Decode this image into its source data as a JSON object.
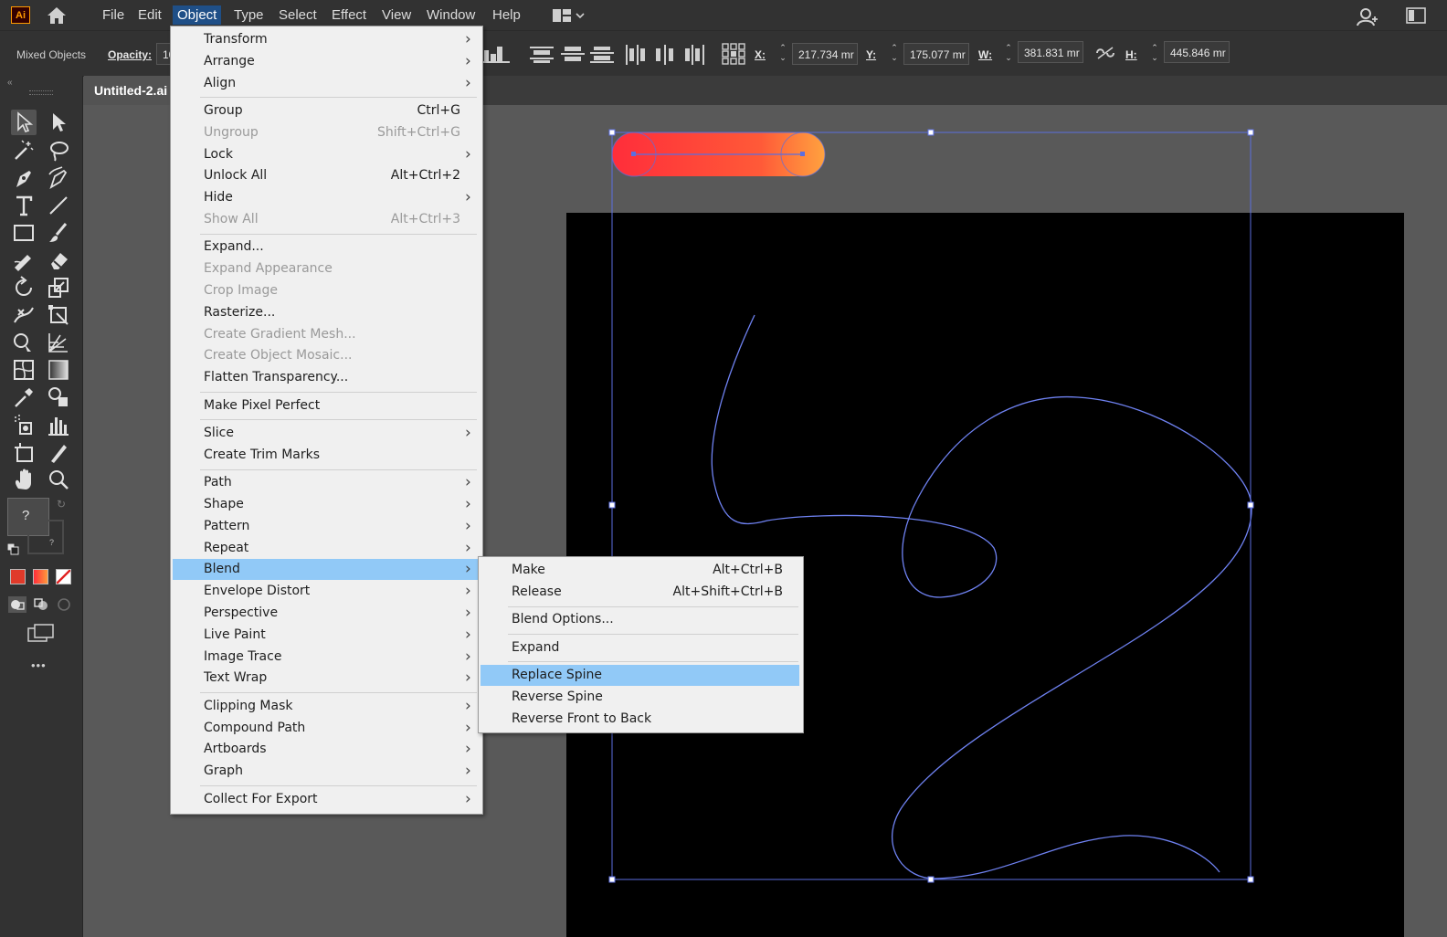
{
  "app": {
    "logo": "Ai"
  },
  "menubar": {
    "items": [
      "File",
      "Edit",
      "Object",
      "Type",
      "Select",
      "Effect",
      "View",
      "Window",
      "Help"
    ],
    "active": "Object"
  },
  "controlbar": {
    "selection_label": "Mixed Objects",
    "opacity_label": "Opacity:",
    "opacity_value": "10",
    "x_label": "X:",
    "x_value": "217.734 mr",
    "y_label": "Y:",
    "y_value": "175.077 mr",
    "w_label": "W:",
    "w_value": "381.831 mr",
    "h_label": "H:",
    "h_value": "445.846 mr"
  },
  "document": {
    "tab_title": "Untitled-2.ai"
  },
  "toolbar": {
    "fill_stroke_unknown": "?",
    "more": "•••"
  },
  "object_menu": [
    {
      "label": "Transform",
      "shortcut": "",
      "submenu": true,
      "disabled": false
    },
    {
      "label": "Arrange",
      "shortcut": "",
      "submenu": true,
      "disabled": false
    },
    {
      "label": "Align",
      "shortcut": "",
      "submenu": true,
      "disabled": false,
      "sep_after": true
    },
    {
      "label": "Group",
      "shortcut": "Ctrl+G",
      "submenu": false,
      "disabled": false
    },
    {
      "label": "Ungroup",
      "shortcut": "Shift+Ctrl+G",
      "submenu": false,
      "disabled": true
    },
    {
      "label": "Lock",
      "shortcut": "",
      "submenu": true,
      "disabled": false
    },
    {
      "label": "Unlock All",
      "shortcut": "Alt+Ctrl+2",
      "submenu": false,
      "disabled": false
    },
    {
      "label": "Hide",
      "shortcut": "",
      "submenu": true,
      "disabled": false
    },
    {
      "label": "Show All",
      "shortcut": "Alt+Ctrl+3",
      "submenu": false,
      "disabled": true,
      "sep_after": true
    },
    {
      "label": "Expand...",
      "shortcut": "",
      "submenu": false,
      "disabled": false
    },
    {
      "label": "Expand Appearance",
      "shortcut": "",
      "submenu": false,
      "disabled": true
    },
    {
      "label": "Crop Image",
      "shortcut": "",
      "submenu": false,
      "disabled": true
    },
    {
      "label": "Rasterize...",
      "shortcut": "",
      "submenu": false,
      "disabled": false
    },
    {
      "label": "Create Gradient Mesh...",
      "shortcut": "",
      "submenu": false,
      "disabled": true
    },
    {
      "label": "Create Object Mosaic...",
      "shortcut": "",
      "submenu": false,
      "disabled": true
    },
    {
      "label": "Flatten Transparency...",
      "shortcut": "",
      "submenu": false,
      "disabled": false,
      "sep_after": true
    },
    {
      "label": "Make Pixel Perfect",
      "shortcut": "",
      "submenu": false,
      "disabled": false,
      "sep_after": true
    },
    {
      "label": "Slice",
      "shortcut": "",
      "submenu": true,
      "disabled": false
    },
    {
      "label": "Create Trim Marks",
      "shortcut": "",
      "submenu": false,
      "disabled": false,
      "sep_after": true
    },
    {
      "label": "Path",
      "shortcut": "",
      "submenu": true,
      "disabled": false
    },
    {
      "label": "Shape",
      "shortcut": "",
      "submenu": true,
      "disabled": false
    },
    {
      "label": "Pattern",
      "shortcut": "",
      "submenu": true,
      "disabled": false
    },
    {
      "label": "Repeat",
      "shortcut": "",
      "submenu": true,
      "disabled": false
    },
    {
      "label": "Blend",
      "shortcut": "",
      "submenu": true,
      "disabled": false,
      "highlighted": true
    },
    {
      "label": "Envelope Distort",
      "shortcut": "",
      "submenu": true,
      "disabled": false
    },
    {
      "label": "Perspective",
      "shortcut": "",
      "submenu": true,
      "disabled": false
    },
    {
      "label": "Live Paint",
      "shortcut": "",
      "submenu": true,
      "disabled": false
    },
    {
      "label": "Image Trace",
      "shortcut": "",
      "submenu": true,
      "disabled": false
    },
    {
      "label": "Text Wrap",
      "shortcut": "",
      "submenu": true,
      "disabled": false,
      "sep_after": true
    },
    {
      "label": "Clipping Mask",
      "shortcut": "",
      "submenu": true,
      "disabled": false
    },
    {
      "label": "Compound Path",
      "shortcut": "",
      "submenu": true,
      "disabled": false
    },
    {
      "label": "Artboards",
      "shortcut": "",
      "submenu": true,
      "disabled": false
    },
    {
      "label": "Graph",
      "shortcut": "",
      "submenu": true,
      "disabled": false,
      "sep_after": true
    },
    {
      "label": "Collect For Export",
      "shortcut": "",
      "submenu": true,
      "disabled": false
    }
  ],
  "blend_submenu": [
    {
      "label": "Make",
      "shortcut": "Alt+Ctrl+B"
    },
    {
      "label": "Release",
      "shortcut": "Alt+Shift+Ctrl+B",
      "sep_after": true
    },
    {
      "label": "Blend Options...",
      "shortcut": "",
      "sep_after": true
    },
    {
      "label": "Expand",
      "shortcut": "",
      "sep_after": true
    },
    {
      "label": "Replace Spine",
      "shortcut": "",
      "highlighted": true
    },
    {
      "label": "Reverse Spine",
      "shortcut": ""
    },
    {
      "label": "Reverse Front to Back",
      "shortcut": ""
    }
  ],
  "colors": {
    "menu_highlight": "#91c9f7",
    "selection_blue": "#5b6ee0",
    "gradient_start": "#ff2d3a",
    "gradient_end": "#ff9a3c"
  }
}
